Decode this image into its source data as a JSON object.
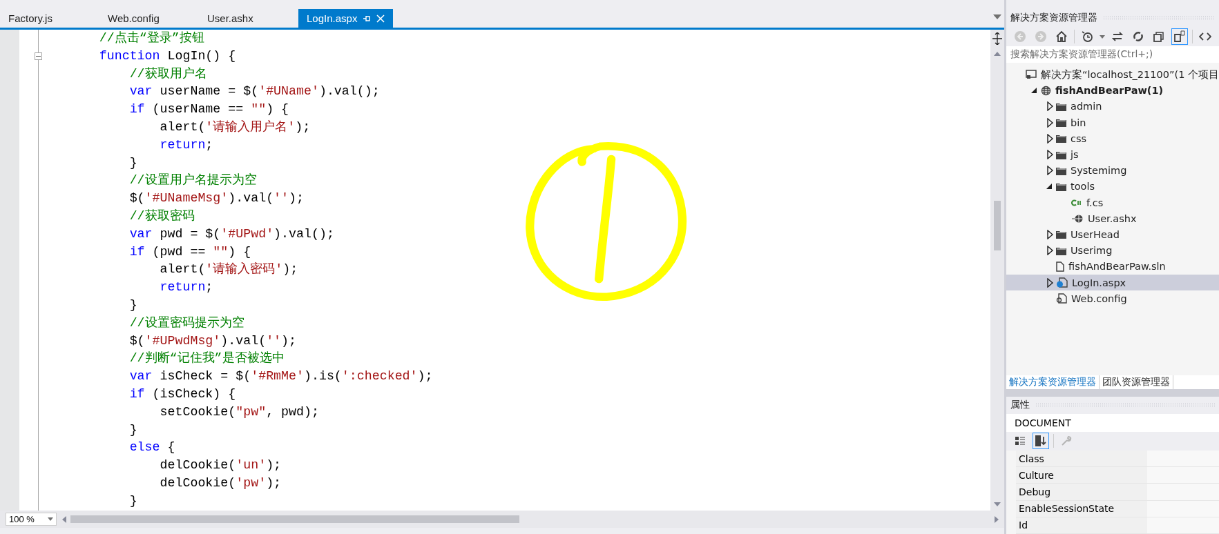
{
  "tabs": [
    {
      "label": "Factory.js",
      "selected": false
    },
    {
      "label": "Web.config",
      "selected": false
    },
    {
      "label": "User.ashx",
      "selected": false
    },
    {
      "label": "LogIn.aspx",
      "selected": true
    }
  ],
  "code_lines": [
    {
      "fold": false,
      "tokens": [
        {
          "kind": "comment",
          "text": "        //点击“登录”按钮"
        }
      ]
    },
    {
      "fold": true,
      "tokens": [
        {
          "kind": "keyword",
          "text": "        function"
        },
        {
          "kind": "plain",
          "text": " LogIn() {"
        }
      ]
    },
    {
      "fold": false,
      "tokens": [
        {
          "kind": "comment",
          "text": "            //获取用户名"
        }
      ]
    },
    {
      "fold": false,
      "tokens": [
        {
          "kind": "keyword",
          "text": "            var"
        },
        {
          "kind": "plain",
          "text": " userName = $("
        },
        {
          "kind": "string",
          "text": "'#UName'"
        },
        {
          "kind": "plain",
          "text": ").val();"
        }
      ]
    },
    {
      "fold": false,
      "tokens": [
        {
          "kind": "keyword",
          "text": "            if"
        },
        {
          "kind": "plain",
          "text": " (userName == "
        },
        {
          "kind": "string",
          "text": "\"\""
        },
        {
          "kind": "plain",
          "text": ") {"
        }
      ]
    },
    {
      "fold": false,
      "tokens": [
        {
          "kind": "plain",
          "text": "                alert("
        },
        {
          "kind": "string",
          "text": "'请输入用户名'"
        },
        {
          "kind": "plain",
          "text": ");"
        }
      ]
    },
    {
      "fold": false,
      "tokens": [
        {
          "kind": "keyword",
          "text": "                return"
        },
        {
          "kind": "plain",
          "text": ";"
        }
      ]
    },
    {
      "fold": false,
      "tokens": [
        {
          "kind": "plain",
          "text": "            }"
        }
      ]
    },
    {
      "fold": false,
      "tokens": [
        {
          "kind": "comment",
          "text": "            //设置用户名提示为空"
        }
      ]
    },
    {
      "fold": false,
      "tokens": [
        {
          "kind": "plain",
          "text": "            $("
        },
        {
          "kind": "string",
          "text": "'#UNameMsg'"
        },
        {
          "kind": "plain",
          "text": ").val("
        },
        {
          "kind": "string",
          "text": "''"
        },
        {
          "kind": "plain",
          "text": ");"
        }
      ]
    },
    {
      "fold": false,
      "tokens": [
        {
          "kind": "comment",
          "text": "            //获取密码"
        }
      ]
    },
    {
      "fold": false,
      "tokens": [
        {
          "kind": "keyword",
          "text": "            var"
        },
        {
          "kind": "plain",
          "text": " pwd = $("
        },
        {
          "kind": "string",
          "text": "'#UPwd'"
        },
        {
          "kind": "plain",
          "text": ").val();"
        }
      ]
    },
    {
      "fold": false,
      "tokens": [
        {
          "kind": "keyword",
          "text": "            if"
        },
        {
          "kind": "plain",
          "text": " (pwd == "
        },
        {
          "kind": "string",
          "text": "\"\""
        },
        {
          "kind": "plain",
          "text": ") {"
        }
      ]
    },
    {
      "fold": false,
      "tokens": [
        {
          "kind": "plain",
          "text": "                alert("
        },
        {
          "kind": "string",
          "text": "'请输入密码'"
        },
        {
          "kind": "plain",
          "text": ");"
        }
      ]
    },
    {
      "fold": false,
      "tokens": [
        {
          "kind": "keyword",
          "text": "                return"
        },
        {
          "kind": "plain",
          "text": ";"
        }
      ]
    },
    {
      "fold": false,
      "tokens": [
        {
          "kind": "plain",
          "text": "            }"
        }
      ]
    },
    {
      "fold": false,
      "tokens": [
        {
          "kind": "comment",
          "text": "            //设置密码提示为空"
        }
      ]
    },
    {
      "fold": false,
      "tokens": [
        {
          "kind": "plain",
          "text": "            $("
        },
        {
          "kind": "string",
          "text": "'#UPwdMsg'"
        },
        {
          "kind": "plain",
          "text": ").val("
        },
        {
          "kind": "string",
          "text": "''"
        },
        {
          "kind": "plain",
          "text": ");"
        }
      ]
    },
    {
      "fold": false,
      "tokens": [
        {
          "kind": "comment",
          "text": "            //判断“记住我”是否被选中"
        }
      ]
    },
    {
      "fold": false,
      "tokens": [
        {
          "kind": "keyword",
          "text": "            var"
        },
        {
          "kind": "plain",
          "text": " isCheck = $("
        },
        {
          "kind": "string",
          "text": "'#RmMe'"
        },
        {
          "kind": "plain",
          "text": ").is("
        },
        {
          "kind": "string",
          "text": "':checked'"
        },
        {
          "kind": "plain",
          "text": ");"
        }
      ]
    },
    {
      "fold": false,
      "tokens": [
        {
          "kind": "keyword",
          "text": "            if"
        },
        {
          "kind": "plain",
          "text": " (isCheck) {"
        }
      ]
    },
    {
      "fold": false,
      "tokens": [
        {
          "kind": "plain",
          "text": "                setCookie("
        },
        {
          "kind": "string",
          "text": "\"pw\""
        },
        {
          "kind": "plain",
          "text": ", pwd);"
        }
      ]
    },
    {
      "fold": false,
      "tokens": [
        {
          "kind": "plain",
          "text": "            }"
        }
      ]
    },
    {
      "fold": false,
      "tokens": [
        {
          "kind": "keyword",
          "text": "            else"
        },
        {
          "kind": "plain",
          "text": " {"
        }
      ]
    },
    {
      "fold": false,
      "tokens": [
        {
          "kind": "plain",
          "text": "                delCookie("
        },
        {
          "kind": "string",
          "text": "'un'"
        },
        {
          "kind": "plain",
          "text": ");"
        }
      ]
    },
    {
      "fold": false,
      "tokens": [
        {
          "kind": "plain",
          "text": "                delCookie("
        },
        {
          "kind": "string",
          "text": "'pw'"
        },
        {
          "kind": "plain",
          "text": ");"
        }
      ]
    },
    {
      "fold": false,
      "tokens": [
        {
          "kind": "plain",
          "text": "            }"
        }
      ]
    }
  ],
  "zoom": "100 %",
  "solution_explorer": {
    "title": "解决方案资源管理器",
    "search": {
      "placeholder": "搜索解决方案资源管理器(Ctrl+;)"
    },
    "tree": [
      {
        "kind": "solution",
        "label": "解决方案“localhost_21100”(1 个项目",
        "selected": false,
        "children": [
          {
            "kind": "project",
            "label": "fishAndBearPaw(1)",
            "selected": false,
            "expanded": true,
            "children": [
              {
                "kind": "folder",
                "label": "admin",
                "selected": false,
                "expanded": false
              },
              {
                "kind": "folder",
                "label": "bin",
                "selected": false,
                "expanded": false
              },
              {
                "kind": "folder",
                "label": "css",
                "selected": false,
                "expanded": false
              },
              {
                "kind": "folder",
                "label": "js",
                "selected": false,
                "expanded": false
              },
              {
                "kind": "folder",
                "label": "Systemimg",
                "selected": false,
                "expanded": false
              },
              {
                "kind": "folder",
                "label": "tools",
                "selected": false,
                "expanded": true,
                "children": [
                  {
                    "kind": "csharp",
                    "label": "f.cs",
                    "selected": false
                  },
                  {
                    "kind": "handler",
                    "label": "User.ashx",
                    "selected": false
                  }
                ]
              },
              {
                "kind": "folder",
                "label": "UserHead",
                "selected": false,
                "expanded": false
              },
              {
                "kind": "folder",
                "label": "Userimg",
                "selected": false,
                "expanded": false
              },
              {
                "kind": "file",
                "label": "fishAndBearPaw.sln",
                "selected": false
              },
              {
                "kind": "page",
                "label": "LogIn.aspx",
                "selected": true,
                "expanded": false
              },
              {
                "kind": "config",
                "label": "Web.config",
                "selected": false
              }
            ]
          }
        ]
      }
    ]
  },
  "panel_tabs": [
    {
      "label": "解决方案资源管理器",
      "selected": true
    },
    {
      "label": "团队资源管理器",
      "selected": false
    }
  ],
  "properties": {
    "title": "属性",
    "object": "DOCUMENT",
    "rows": [
      {
        "name": "Class"
      },
      {
        "name": "Culture"
      },
      {
        "name": "Debug"
      },
      {
        "name": "EnableSessionState"
      },
      {
        "name": "Id"
      }
    ]
  }
}
